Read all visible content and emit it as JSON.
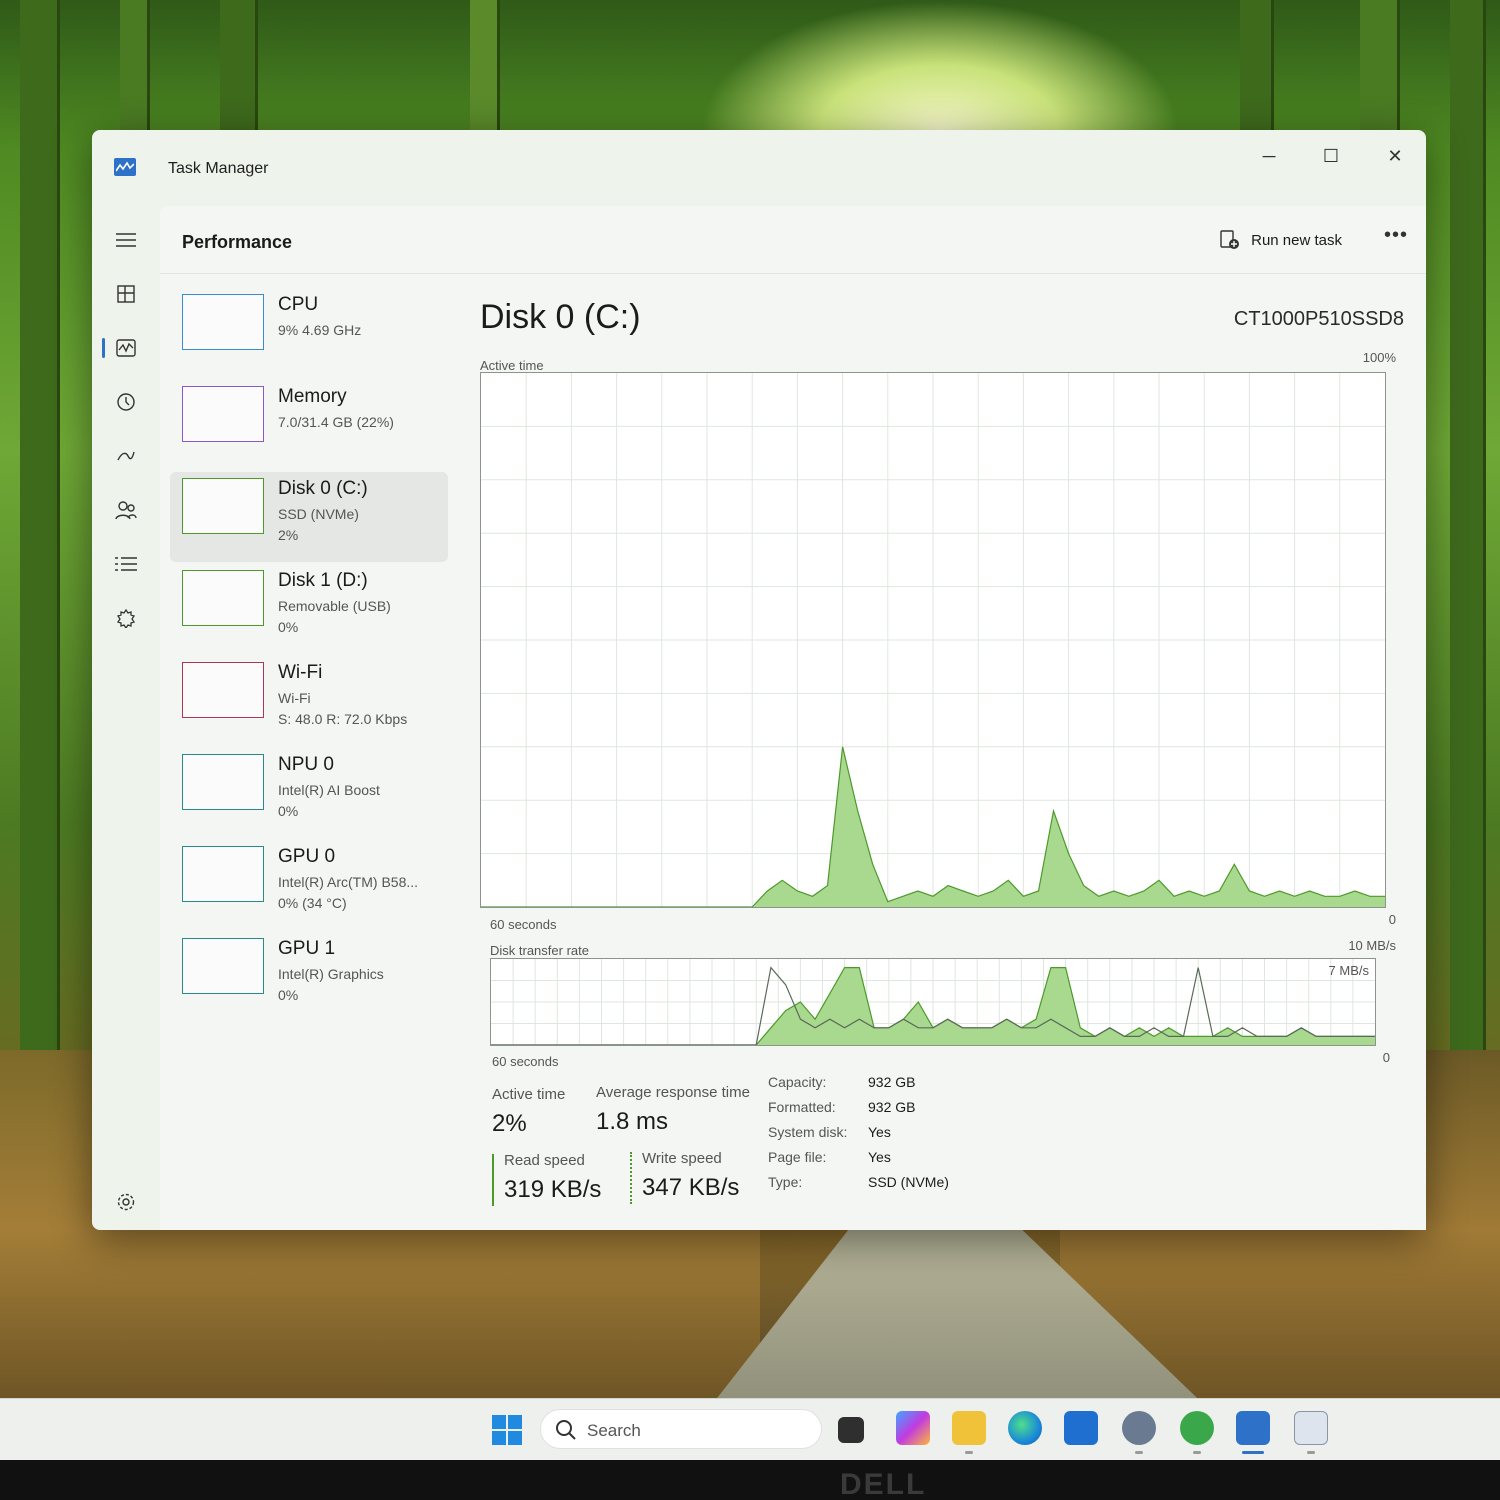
{
  "window": {
    "title": "Task Manager",
    "controls": {
      "minimize": "─",
      "maximize": "☐",
      "close": "✕"
    }
  },
  "nav": {
    "items": [
      "menu-icon",
      "processes-icon",
      "performance-icon",
      "app-history-icon",
      "startup-apps-icon",
      "users-icon",
      "details-icon",
      "services-icon"
    ],
    "settings": "settings-icon",
    "active": "performance-icon"
  },
  "header": {
    "title": "Performance",
    "run_new_task": "Run new task",
    "more": "•••"
  },
  "resources": [
    {
      "name": "CPU",
      "sub1": "9%  4.69 GHz",
      "sub2": "",
      "color": "#3b8fc9",
      "selected": false
    },
    {
      "name": "Memory",
      "sub1": "7.0/31.4 GB (22%)",
      "sub2": "",
      "color": "#8a59c4",
      "selected": false
    },
    {
      "name": "Disk 0 (C:)",
      "sub1": "SSD (NVMe)",
      "sub2": "2%",
      "color": "#4c9a2a",
      "selected": true
    },
    {
      "name": "Disk 1 (D:)",
      "sub1": "Removable (USB)",
      "sub2": "0%",
      "color": "#4c9a2a",
      "selected": false
    },
    {
      "name": "Wi-Fi",
      "sub1": "Wi-Fi",
      "sub2": "S: 48.0  R: 72.0 Kbps",
      "color": "#a7385a",
      "selected": false
    },
    {
      "name": "NPU 0",
      "sub1": "Intel(R) AI Boost",
      "sub2": "0%",
      "color": "#2a8a8a",
      "selected": false
    },
    {
      "name": "GPU 0",
      "sub1": "Intel(R) Arc(TM) B58...",
      "sub2": "0%  (34 °C)",
      "color": "#2a8a8a",
      "selected": false
    },
    {
      "name": "GPU 1",
      "sub1": "Intel(R) Graphics",
      "sub2": "0%",
      "color": "#2a8a8a",
      "selected": false
    }
  ],
  "disk": {
    "title": "Disk 0 (C:)",
    "model": "CT1000P510SSD8",
    "active_chart": {
      "label": "Active time",
      "max_label": "100%",
      "x_label": "60 seconds",
      "min_label": "0"
    },
    "transfer_chart": {
      "label": "Disk transfer rate",
      "max_label": "10 MB/s",
      "secondary_label": "7 MB/s",
      "x_label": "60 seconds",
      "min_label": "0"
    },
    "stats": {
      "active_time_label": "Active time",
      "active_time": "2%",
      "avg_response_label": "Average response time",
      "avg_response": "1.8 ms",
      "read_speed_label": "Read speed",
      "read_speed": "319 KB/s",
      "write_speed_label": "Write speed",
      "write_speed": "347 KB/s"
    },
    "properties": [
      {
        "key": "Capacity:",
        "value": "932 GB"
      },
      {
        "key": "Formatted:",
        "value": "932 GB"
      },
      {
        "key": "System disk:",
        "value": "Yes"
      },
      {
        "key": "Page file:",
        "value": "Yes"
      },
      {
        "key": "Type:",
        "value": "SSD (NVMe)"
      }
    ]
  },
  "chart_data": {
    "type": "area",
    "title": "Active time",
    "ylabel": "",
    "xlabel": "60 seconds",
    "ylim": [
      0,
      100
    ],
    "x": [
      0,
      1,
      2,
      3,
      4,
      5,
      6,
      7,
      8,
      9,
      10,
      11,
      12,
      13,
      14,
      15,
      16,
      17,
      18,
      19,
      20,
      21,
      22,
      23,
      24,
      25,
      26,
      27,
      28,
      29,
      30,
      31,
      32,
      33,
      34,
      35,
      36,
      37,
      38,
      39,
      40,
      41,
      42,
      43,
      44,
      45,
      46,
      47,
      48,
      49,
      50,
      51,
      52,
      53,
      54,
      55,
      56,
      57,
      58,
      59,
      60
    ],
    "series": [
      {
        "values": [
          0,
          0,
          0,
          0,
          0,
          0,
          0,
          0,
          0,
          0,
          0,
          0,
          0,
          0,
          0,
          0,
          0,
          0,
          0,
          3,
          5,
          3,
          2,
          4,
          30,
          18,
          8,
          1,
          2,
          3,
          2,
          4,
          3,
          2,
          3,
          5,
          2,
          3,
          18,
          10,
          4,
          2,
          3,
          2,
          3,
          5,
          2,
          3,
          2,
          3,
          8,
          3,
          2,
          3,
          2,
          3,
          2,
          2,
          3,
          2,
          2
        ]
      }
    ],
    "transfer_series": [
      {
        "values": [
          0,
          0,
          0,
          0,
          0,
          0,
          0,
          0,
          0,
          0,
          0,
          0,
          0,
          0,
          0,
          0,
          0,
          0,
          0,
          2,
          4,
          5,
          3,
          6,
          9,
          9,
          2,
          2,
          3,
          5,
          2,
          3,
          2,
          2,
          2,
          3,
          2,
          3,
          9,
          9,
          2,
          1,
          2,
          1,
          2,
          1,
          2,
          1,
          1,
          1,
          2,
          1,
          1,
          1,
          1,
          2,
          1,
          1,
          1,
          1,
          1
        ]
      },
      {
        "values": [
          0,
          0,
          0,
          0,
          0,
          0,
          0,
          0,
          0,
          0,
          0,
          0,
          0,
          0,
          0,
          0,
          0,
          0,
          0,
          9,
          7,
          3,
          2,
          3,
          2,
          3,
          2,
          2,
          3,
          2,
          2,
          3,
          2,
          2,
          2,
          3,
          2,
          2,
          3,
          2,
          1,
          1,
          2,
          1,
          1,
          2,
          1,
          1,
          9,
          1,
          1,
          2,
          1,
          1,
          1,
          2,
          1,
          1,
          1,
          1,
          1
        ]
      }
    ],
    "transfer_ylim": [
      0,
      10
    ]
  },
  "taskbar": {
    "search_label": "Search",
    "apps": [
      "start-icon",
      "task-view-icon",
      "m365-icon",
      "file-explorer-icon",
      "edge-icon",
      "store-icon",
      "settings-app-icon",
      "network-app-icon",
      "task-manager-icon",
      "snip-icon"
    ]
  },
  "bezel": {
    "logo": "DELL"
  }
}
